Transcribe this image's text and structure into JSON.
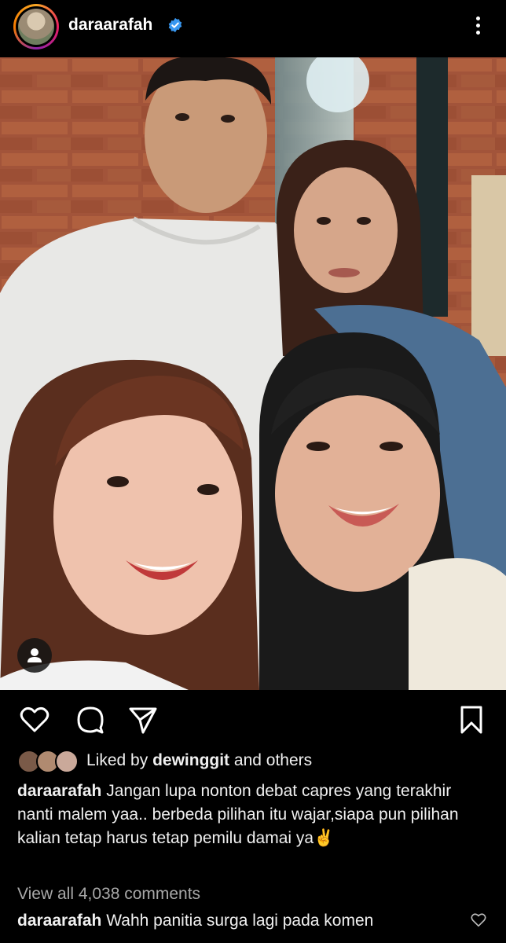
{
  "post": {
    "username": "daraarafah",
    "verified": true,
    "photo_description_icon": "photo",
    "actions": {
      "like_icon": "heart-icon",
      "comment_icon": "comment-icon",
      "share_icon": "send-icon",
      "save_icon": "bookmark-icon"
    },
    "likes": {
      "prefix": "Liked by",
      "user": "dewinggit",
      "suffix": "and others"
    },
    "caption": {
      "author": "daraarafah",
      "text": "Jangan lupa nonton debat capres yang terakhir nanti malem yaa.. berbeda pilihan itu wajar,siapa pun pilihan kalian tetap harus tetap pemilu damai ya✌️"
    },
    "view_comments": "View all 4,038 comments",
    "top_comment": {
      "author": "daraarafah",
      "text": "Wahh panitia surga lagi pada komen"
    }
  },
  "colors": {
    "background": "#000000",
    "verified_blue": "#3897f0",
    "secondary_text": "#a8a8a8"
  }
}
